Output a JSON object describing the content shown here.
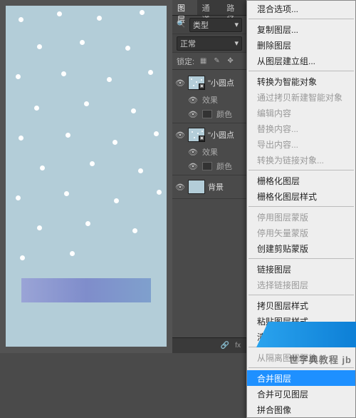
{
  "layersPanel": {
    "tabs": [
      "图层",
      "通道",
      "路径"
    ],
    "kindLabel": "类型",
    "blendMode": "正常",
    "lockLabel": "锁定:",
    "layers": [
      {
        "name": "\"小圆点",
        "fx1": "效果",
        "fx2": "颜色"
      },
      {
        "name": "\"小圆点",
        "fx1": "效果",
        "fx2": "颜色"
      },
      {
        "name": "背景"
      }
    ],
    "footerFx": "fx"
  },
  "contextMenu": {
    "items": [
      {
        "label": "混合选项...",
        "enabled": true
      },
      {
        "sep": true
      },
      {
        "label": "复制图层...",
        "enabled": true
      },
      {
        "label": "删除图层",
        "enabled": true
      },
      {
        "label": "从图层建立组...",
        "enabled": true
      },
      {
        "sep": true
      },
      {
        "label": "转换为智能对象",
        "enabled": true
      },
      {
        "label": "通过拷贝新建智能对象",
        "enabled": false
      },
      {
        "label": "编辑内容",
        "enabled": false
      },
      {
        "label": "替换内容...",
        "enabled": false
      },
      {
        "label": "导出内容...",
        "enabled": false
      },
      {
        "label": "转换为链接对象...",
        "enabled": false
      },
      {
        "sep": true
      },
      {
        "label": "栅格化图层",
        "enabled": true
      },
      {
        "label": "栅格化图层样式",
        "enabled": true
      },
      {
        "sep": true
      },
      {
        "label": "停用图层蒙版",
        "enabled": false
      },
      {
        "label": "停用矢量蒙版",
        "enabled": false
      },
      {
        "label": "创建剪贴蒙版",
        "enabled": true
      },
      {
        "sep": true
      },
      {
        "label": "链接图层",
        "enabled": true
      },
      {
        "label": "选择链接图层",
        "enabled": false
      },
      {
        "sep": true
      },
      {
        "label": "拷贝图层样式",
        "enabled": true
      },
      {
        "label": "粘贴图层样式",
        "enabled": true
      },
      {
        "label": "清除图层样式",
        "enabled": true
      },
      {
        "sep": true
      },
      {
        "label": "从隔离图层释放",
        "enabled": false
      },
      {
        "sep": true
      },
      {
        "label": "合并图层",
        "enabled": true,
        "highlight": true
      },
      {
        "label": "合并可见图层",
        "enabled": true
      },
      {
        "label": "拼合图像",
        "enabled": true
      }
    ]
  },
  "watermark": "世字典教程 jb"
}
